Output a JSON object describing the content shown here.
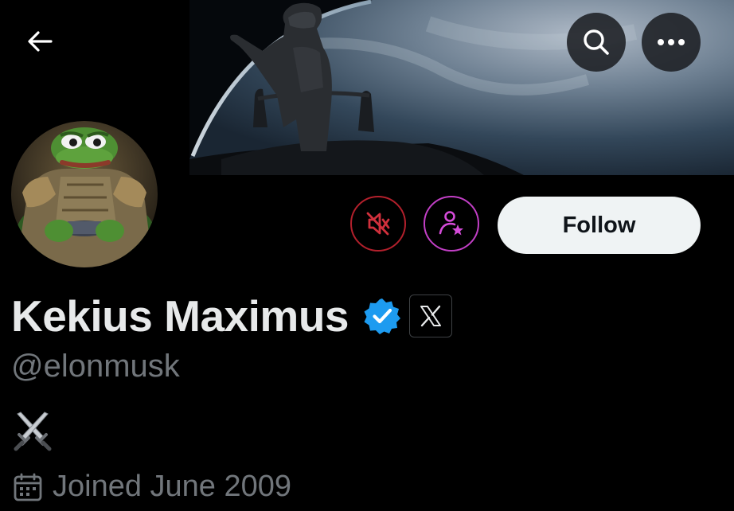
{
  "header": {
    "back_icon": "arrow-left-icon",
    "search_icon": "search-icon",
    "more_icon": "more-horizontal-icon"
  },
  "profile": {
    "display_name": "Kekius Maximus",
    "handle": "@elonmusk",
    "verified_badge": "verified-checkmark-icon",
    "affiliation_badge": "X",
    "bio": "⚔️",
    "joined": "Joined June 2009"
  },
  "actions": {
    "mute_icon": "notifications-muted-icon",
    "subscribe_icon": "subscribe-star-icon",
    "follow_label": "Follow"
  },
  "colors": {
    "background": "#000000",
    "text_primary": "#e7e9ea",
    "text_secondary": "#71767b",
    "follow_bg": "#eff3f4",
    "mute_ring": "#b3202c",
    "subscribe_ring": "#c23fc6",
    "verified_blue": "#1d9bf0"
  }
}
